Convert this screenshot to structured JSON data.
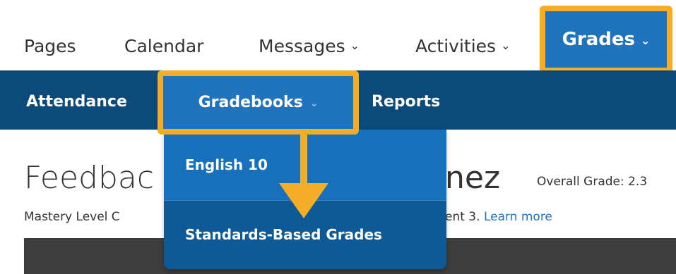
{
  "top_nav": {
    "items": [
      {
        "label": "Pages",
        "has_dropdown": false
      },
      {
        "label": "Calendar",
        "has_dropdown": false
      },
      {
        "label": "Messages",
        "has_dropdown": true
      },
      {
        "label": "Activities",
        "has_dropdown": true
      },
      {
        "label": "Grades",
        "has_dropdown": true,
        "active": true
      }
    ],
    "chevron_glyph": "⌄"
  },
  "sub_nav": {
    "items": [
      {
        "label": "Attendance"
      },
      {
        "label": "Gradebooks",
        "has_dropdown": true,
        "active": true
      },
      {
        "label": "Reports"
      }
    ]
  },
  "dropdown": {
    "items": [
      {
        "label": "English 10",
        "hover": true
      },
      {
        "label": "Standards-Based Grades"
      }
    ]
  },
  "page": {
    "title_left": "Feedbac",
    "title_right": "nez",
    "overall_grade": "Overall Grade: 2.3",
    "mastery_left": "Mastery Level C",
    "mastery_right": "ent 3.",
    "learn_more": "Learn more"
  },
  "colors": {
    "primary_blue": "#1f74bd",
    "dark_navy": "#0c4a79",
    "dropdown_bg": "#0d5a96",
    "highlight_orange": "#f5ad28",
    "text_dark": "#333333",
    "band_dark": "#3d3d3d"
  },
  "icons": {
    "chevron": "chevron-down-icon",
    "callout": "callout-arrow-icon"
  }
}
